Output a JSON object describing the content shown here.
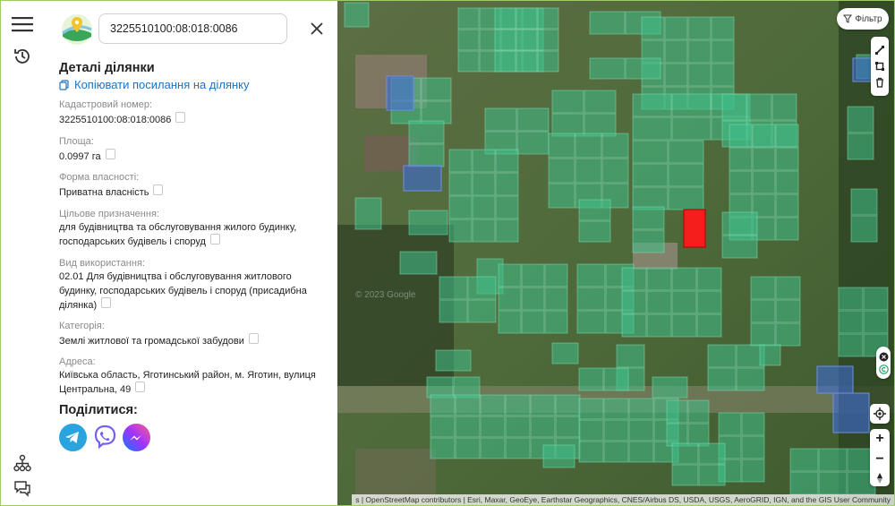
{
  "search": {
    "value": "3225510100:08:018:0086"
  },
  "details": {
    "title": "Деталі ділянки",
    "copy_link": "Копіювати посилання на ділянку",
    "cadastral_label": "Кадастровий номер:",
    "cadastral_value": "3225510100:08:018:0086",
    "area_label": "Площа:",
    "area_value": "0.0997 га",
    "ownership_label": "Форма власності:",
    "ownership_value": "Приватна власність",
    "purpose_label": "Цільове призначення:",
    "purpose_value_1": "для будівництва та обслуговування жилого будинку,",
    "purpose_value_2": "господарських будівель і споруд",
    "use_label": "Вид використання:",
    "use_value_1": "02.01 Для будівництва і обслуговування житлового",
    "use_value_2": "будинку, господарських будівель і споруд (присадибна",
    "use_value_3": "ділянка)",
    "category_label": "Категорія:",
    "category_value": "Землі житлової та громадської забудови",
    "address_label": "Адреса:",
    "address_value_1": "Київська область, Яготинський район, м. Яготин, вулиця",
    "address_value_2": "Центральна, 49"
  },
  "share": {
    "title": "Поділитися:",
    "icons": [
      "telegram-icon",
      "viber-icon",
      "messenger-icon"
    ]
  },
  "map": {
    "filter_label": "Фільтр",
    "watermark": "© 2023 Google",
    "attribution": "s | OpenStreetMap contributors | Esri, Maxar, GeoEye, Earthstar Geographics, CNES/Airbus DS, USDA, USGS, AeroGRID, IGN, and the GIS User Community",
    "colors": {
      "parcel": "#3fbf8a",
      "selected": "#ff1a1a",
      "special": "#3d6bd4"
    },
    "zoom_in": "+",
    "zoom_out": "−"
  },
  "colors": {
    "link": "#1a73c4",
    "accent_border": "#9ccc65",
    "label": "#8a8a8a"
  }
}
